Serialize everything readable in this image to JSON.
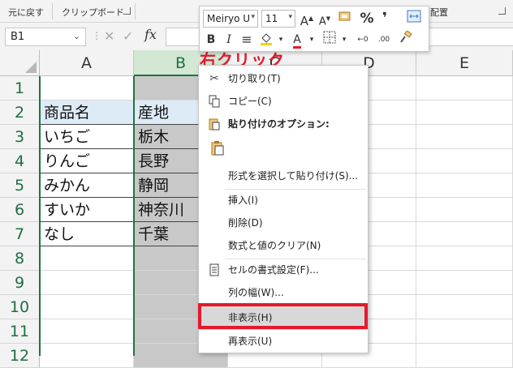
{
  "ribbon": {
    "undo_group_label": "元に戻す",
    "clipboard_group_label": "クリップボード",
    "alignment_group_label": "配置"
  },
  "formula_bar": {
    "name_box": "B1",
    "name_box_dropdown": "⌄",
    "dots": "⋮",
    "cancel": "✕",
    "enter": "✓",
    "fx": "fx",
    "formula": ""
  },
  "grid": {
    "columns": [
      "A",
      "B",
      "C",
      "D",
      "E"
    ],
    "rows": [
      "1",
      "2",
      "3",
      "4",
      "5",
      "6",
      "7",
      "8",
      "9",
      "10",
      "11",
      "12"
    ],
    "selected_column": "B",
    "header_fill": "#ddebf7",
    "table": [
      [
        "商品名",
        "産地"
      ],
      [
        "いちご",
        "栃木"
      ],
      [
        "りんご",
        "長野"
      ],
      [
        "みかん",
        "静岡"
      ],
      [
        "すいか",
        "神奈川"
      ],
      [
        "なし",
        "千葉"
      ]
    ]
  },
  "annotation": {
    "text": "右クリック",
    "color": "#e5192c"
  },
  "mini_toolbar": {
    "font_name": "Meiryo U",
    "font_size": "11",
    "grow_font": "A",
    "shrink_font": "A",
    "percent": "%",
    "comma": "❜",
    "bold": "B",
    "italic": "I",
    "align": "≡",
    "font_color": "A",
    "increase_decimal": "←0",
    "decrease_decimal": ".00",
    "icons": [
      "number-format-icon",
      "merge-center-icon",
      "fill-color-icon",
      "borders-icon",
      "format-painter-icon"
    ]
  },
  "context_menu": {
    "items": [
      {
        "label": "切り取り(T)",
        "icon": "cut-icon"
      },
      {
        "label": "コピー(C)",
        "icon": "copy-icon"
      },
      {
        "label": "貼り付けのオプション:",
        "icon": "paste-icon"
      },
      {
        "label": "形式を選択して貼り付け(S)...",
        "icon": ""
      },
      {
        "label": "挿入(I)",
        "icon": ""
      },
      {
        "label": "削除(D)",
        "icon": ""
      },
      {
        "label": "数式と値のクリア(N)",
        "icon": ""
      },
      {
        "label": "セルの書式設定(F)...",
        "icon": "format-cells-icon"
      },
      {
        "label": "列の幅(W)...",
        "icon": ""
      },
      {
        "label": "非表示(H)",
        "icon": ""
      },
      {
        "label": "再表示(U)",
        "icon": ""
      }
    ],
    "highlighted_item": "非表示(H)",
    "highlight_color": "#e5192c"
  }
}
